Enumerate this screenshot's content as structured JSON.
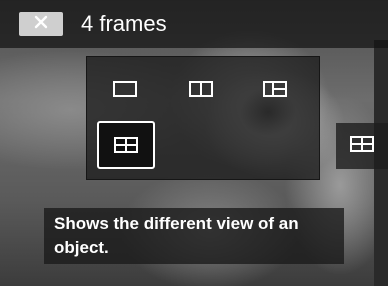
{
  "header": {
    "close_icon": "close-icon",
    "title": "4 frames"
  },
  "frame_options": [
    {
      "icon": "single-frame-icon",
      "selected": false
    },
    {
      "icon": "two-frames-icon",
      "selected": false
    },
    {
      "icon": "three-frames-icon",
      "selected": false
    },
    {
      "icon": "four-frames-icon",
      "selected": true
    },
    {
      "icon": "four-frames-icon",
      "selected": false
    }
  ],
  "help_text": "Shows the different view of an object.",
  "colors": {
    "text": "#ffffff",
    "close_button": "#cfcfcf",
    "selected_border": "#ffffff"
  }
}
